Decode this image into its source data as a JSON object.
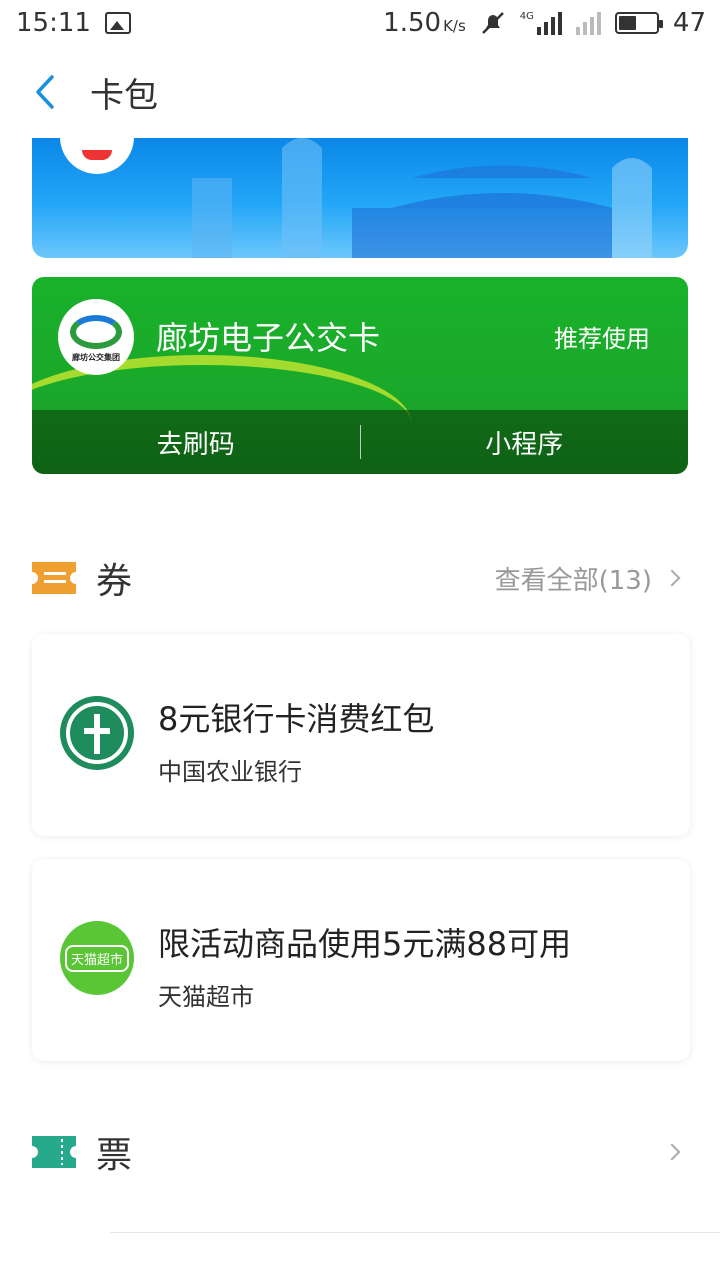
{
  "status_bar": {
    "time": "15:11",
    "net_speed": "1.50",
    "net_unit": "K/s",
    "network_type": "4G",
    "battery_level": "47"
  },
  "header": {
    "title": "卡包",
    "back_icon": "chevron-left-icon"
  },
  "cards": {
    "bus_card": {
      "title": "廊坊电子公交卡",
      "recommend_label": "推荐使用",
      "logo_text": "廊坊公交集团",
      "actions": [
        "去刷码",
        "小程序"
      ]
    }
  },
  "coupons_section": {
    "title": "券",
    "view_all": "查看全部(13)",
    "icon": "coupon-icon",
    "icon_color": "#f0a030",
    "items": [
      {
        "title": "8元银行卡消费红包",
        "subtitle": "中国农业银行",
        "logo": "abc-bank-logo"
      },
      {
        "title": "限活动商品使用5元满88可用",
        "subtitle": "天猫超市",
        "logo": "tmall-market-logo",
        "logo_text": "天猫超市"
      }
    ]
  },
  "tickets_section": {
    "title": "票",
    "icon": "ticket-icon",
    "icon_color": "#27a98b"
  },
  "colors": {
    "accent": "#1a8fe0",
    "bus_card_green": "#1aa82a",
    "city_card_blue": "#23a6f7"
  }
}
